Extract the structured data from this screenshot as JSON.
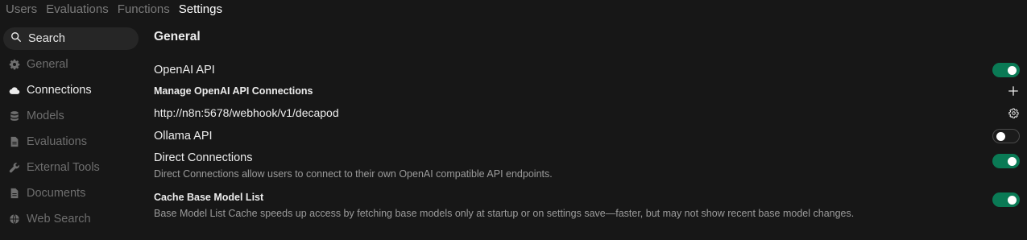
{
  "topnav": {
    "tabs": [
      {
        "label": "Users",
        "active": false
      },
      {
        "label": "Evaluations",
        "active": false
      },
      {
        "label": "Functions",
        "active": false
      },
      {
        "label": "Settings",
        "active": true
      }
    ]
  },
  "sidebar": {
    "search_label": "Search",
    "items": [
      {
        "label": "General",
        "icon": "gear-icon",
        "active": false
      },
      {
        "label": "Connections",
        "icon": "cloud-icon",
        "active": true
      },
      {
        "label": "Models",
        "icon": "database-icon",
        "active": false
      },
      {
        "label": "Evaluations",
        "icon": "document-icon",
        "active": false
      },
      {
        "label": "External Tools",
        "icon": "wrench-icon",
        "active": false
      },
      {
        "label": "Documents",
        "icon": "document-icon",
        "active": false
      },
      {
        "label": "Web Search",
        "icon": "globe-icon",
        "active": false
      }
    ]
  },
  "main": {
    "title": "General",
    "openai_api": {
      "label": "OpenAI API",
      "enabled": true
    },
    "manage_openai": {
      "label": "Manage OpenAI API Connections"
    },
    "connection_url": "http://n8n:5678/webhook/v1/decapod",
    "ollama_api": {
      "label": "Ollama API",
      "enabled": false
    },
    "direct_connections": {
      "label": "Direct Connections",
      "description": "Direct Connections allow users to connect to their own OpenAI compatible API endpoints.",
      "enabled": true
    },
    "cache_base_model_list": {
      "label": "Cache Base Model List",
      "description": "Base Model List Cache speeds up access by fetching base models only at startup or on settings save—faster, but may not show recent base model changes.",
      "enabled": true
    }
  },
  "colors": {
    "background": "#171717",
    "toggle_on": "#0a7a55",
    "muted_text": "#6e6e6e",
    "active_text": "#ececec"
  }
}
